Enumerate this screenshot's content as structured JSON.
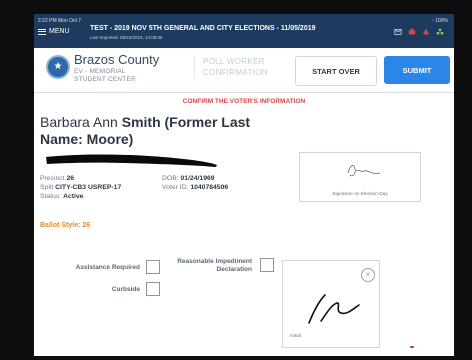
{
  "status": {
    "time": "2:22 PM  Mon Oct 7",
    "battery": "100%"
  },
  "topbar": {
    "menu_label": "MENU",
    "election_title": "TEST - 2019 NOV 5TH GENERAL AND CITY ELECTIONS - 11/05/2019",
    "last_imported": "Last Imported: 09/22/2019, 14:09:05"
  },
  "header": {
    "county": "Brazos County",
    "ev_line1": "EV - MEMORIAL",
    "ev_line2": "STUDENT CENTER",
    "mode_line1": "POLL WORKER",
    "mode_line2": "CONFIRMATION",
    "start_over": "START OVER",
    "submit": "SUBMIT"
  },
  "confirm_heading": "CONFIRM THE VOTER'S INFORMATION",
  "voter": {
    "name_first": "Barbara Ann ",
    "name_last": "Smith",
    "name_former": " (Former Last",
    "name_former2": "Name: Moore)",
    "precinct_label": "Precinct",
    "precinct": "26",
    "split_label": "Split",
    "split": "CITY-CB3 USREP-17",
    "status_label": "Status:",
    "status": "Active",
    "dob_label": "DOB:",
    "dob": "01/24/1969",
    "voter_id_label": "Voter ID:",
    "voter_id": "1040784506"
  },
  "signature_caption": "Signature on Election Day",
  "ballot_style": "Ballot Style: 26",
  "checks": {
    "assistance": "Assistance Required",
    "curbside": "Curbside",
    "impediment_1": "Reasonable Impediment",
    "impediment_2": "Declaration"
  },
  "initial_label": "Initial",
  "colors": {
    "topbar": "#1f3a5f",
    "accent": "#2b86e8",
    "alert": "#e0444a",
    "ballot": "#e48a2b"
  }
}
